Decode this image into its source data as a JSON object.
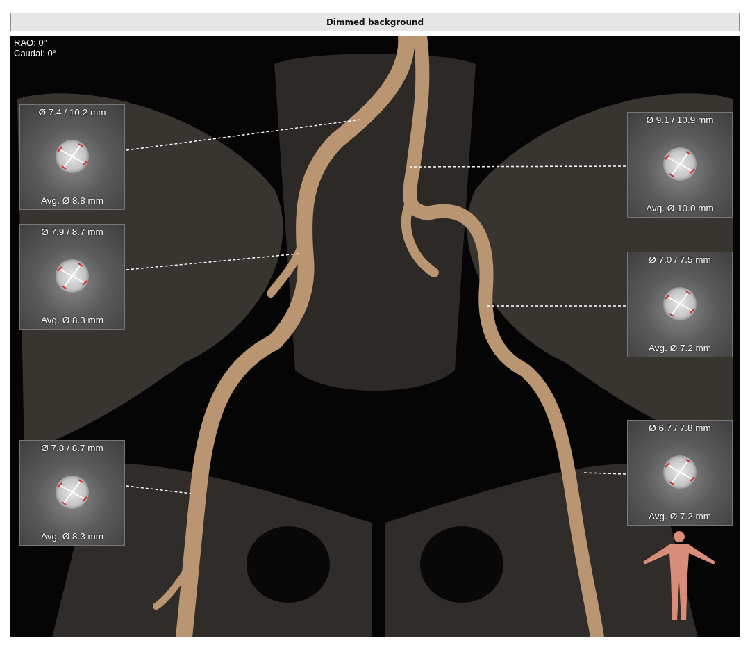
{
  "window": {
    "title": "Dimmed background"
  },
  "view": {
    "orientation": [
      "RAO: 0°",
      "Caudal: 0°"
    ],
    "left_measurements": [
      {
        "diameters": "Ø 7.4 / 10.2 mm",
        "average": "Avg. Ø 8.8 mm"
      },
      {
        "diameters": "Ø 7.9 / 8.7 mm",
        "average": "Avg. Ø 8.3 mm"
      },
      {
        "diameters": "Ø 7.8 / 8.7 mm",
        "average": "Avg. Ø 8.3 mm"
      }
    ],
    "right_measurements": [
      {
        "diameters": "Ø 9.1 / 10.9 mm",
        "average": "Avg. Ø 10.0 mm"
      },
      {
        "diameters": "Ø 7.0 / 7.5 mm",
        "average": "Avg. Ø 7.2 mm"
      },
      {
        "diameters": "Ø 6.7 / 7.8 mm",
        "average": "Avg. Ø 7.2 mm"
      }
    ]
  }
}
